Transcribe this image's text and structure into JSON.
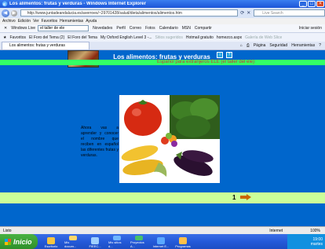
{
  "window": {
    "title": "Los alimentos: frutas y verduras - Windows Internet Explorer",
    "minimize": "_",
    "maximize": "□",
    "close": "×"
  },
  "address": {
    "url": "http://www.juntadeandalucia.es/averroes/~29701428/salud/dieta/alimentos/alimentos.htm",
    "search_placeholder": "Live Search"
  },
  "menu": [
    "Archivo",
    "Edición",
    "Ver",
    "Favoritos",
    "Herramientas",
    "Ayuda"
  ],
  "live_toolbar": {
    "brand": "Windows Live",
    "input_value": "el taller de ele",
    "items": [
      "Novedades",
      "Perfil",
      "Correo",
      "Fotos",
      "Calendario",
      "MSN",
      "Compartir"
    ],
    "signin": "Iniciar sesión"
  },
  "favorites": {
    "label": "Favoritos",
    "items": [
      "El Foro del Tema (2)",
      "El Foro del Tema",
      "My Oxford English Level 3 -...",
      "Sitios sugeridos",
      "Hotmail gratuito",
      "homezco.aspx",
      "Galería de Web Slice"
    ]
  },
  "tab": {
    "label": "Los alimentos: frutas y verduras",
    "tools": [
      "Página",
      "Seguridad",
      "Herramientas"
    ]
  },
  "page": {
    "title": "Los alimentos: frutas y verduras",
    "subtitle": "Español para extranjeros ELE (el taller del ele)",
    "description": "Ahora vas a aprender y conocer el nombre que reciben en español las diferentes frutas y verduras.",
    "page_number": "1",
    "colors": {
      "background": "#0066cc",
      "band": "#33ff66",
      "footer_band": "#ccff99",
      "arrow": "#cc6600"
    }
  },
  "status": {
    "left": "Listo",
    "zone": "Internet",
    "zoom": "100%"
  },
  "taskbar": {
    "start": "Inicio",
    "items": [
      "Escritorio",
      "Mis docum...",
      "FIEEC...",
      "Mis sitios d...",
      "Proyectos A...",
      "Internet E...",
      "Programas"
    ],
    "clock": "19:00",
    "day": "martes"
  }
}
